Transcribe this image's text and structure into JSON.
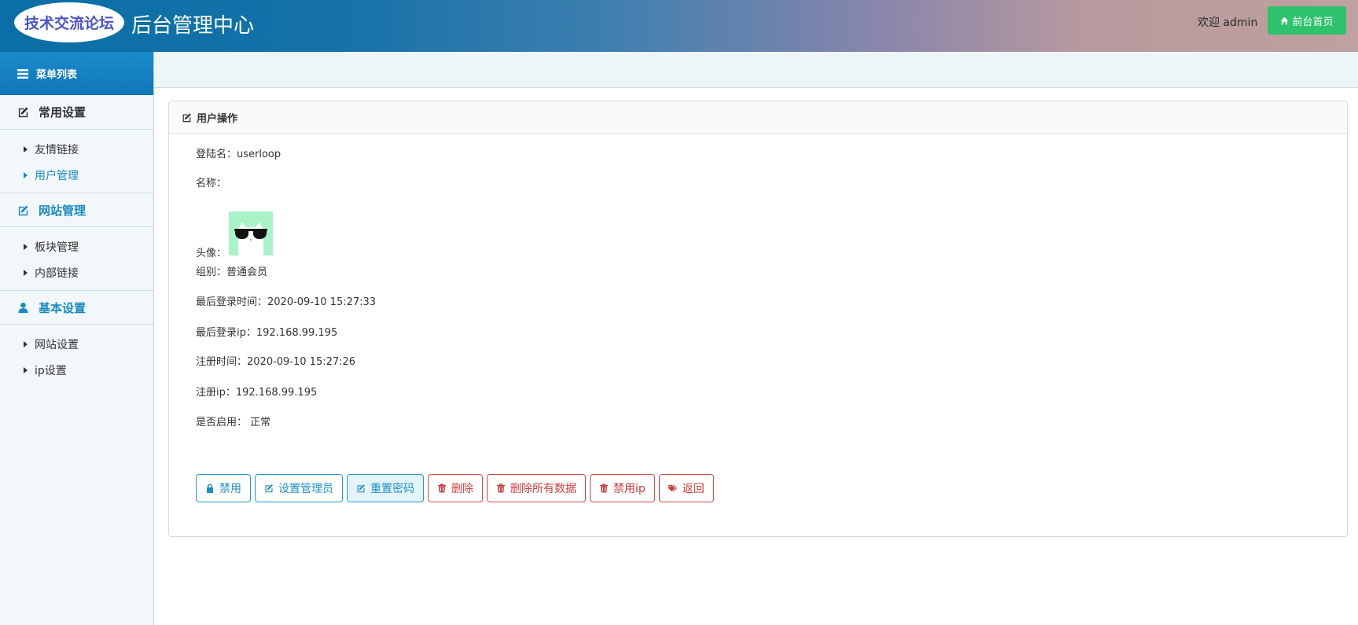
{
  "header": {
    "logo_text": "技术交流论坛",
    "title": "后台管理中心",
    "welcome": "欢迎 admin",
    "home_button": "前台首页",
    "home_icon": "home-icon"
  },
  "sidebar": {
    "menu_title": "菜单列表",
    "groups": [
      {
        "title": "常用设置",
        "icon": "edit-icon",
        "items": [
          {
            "label": "友情链接",
            "active": false
          },
          {
            "label": "用户管理",
            "active": true
          }
        ]
      },
      {
        "title": "网站管理",
        "icon": "edit-icon",
        "items": [
          {
            "label": "板块管理",
            "active": false
          },
          {
            "label": "内部链接",
            "active": false
          }
        ]
      },
      {
        "title": "基本设置",
        "icon": "user-icon",
        "items": [
          {
            "label": "网站设置",
            "active": false
          },
          {
            "label": "ip设置",
            "active": false
          }
        ]
      }
    ]
  },
  "panel": {
    "title": "用户操作",
    "fields": {
      "login_name": "登陆名：userloop",
      "name": "名称：",
      "avatar_label": "头像：",
      "group": "组别：普通会员",
      "last_login_time": "最后登录时间：2020-09-10 15:27:33",
      "last_login_ip": "最后登录ip：192.168.99.195",
      "register_time": "注册时间：2020-09-10 15:27:26",
      "register_ip": "注册ip：192.168.99.195",
      "enabled": "是否启用： 正常"
    },
    "buttons": {
      "disable": "禁用",
      "set_admin": "设置管理员",
      "reset_password": "重置密码",
      "delete": "删除",
      "delete_all": "删除所有数据",
      "ban_ip": "禁用ip",
      "back": "返回"
    }
  },
  "colors": {
    "header_start": "#0a6fa6",
    "header_end": "#c0a0a0",
    "accent_blue": "#1a8ac2",
    "home_button_green": "#2dc26b",
    "danger_red": "#cf3d3d",
    "avatar_bg": "#a9f3c8"
  }
}
